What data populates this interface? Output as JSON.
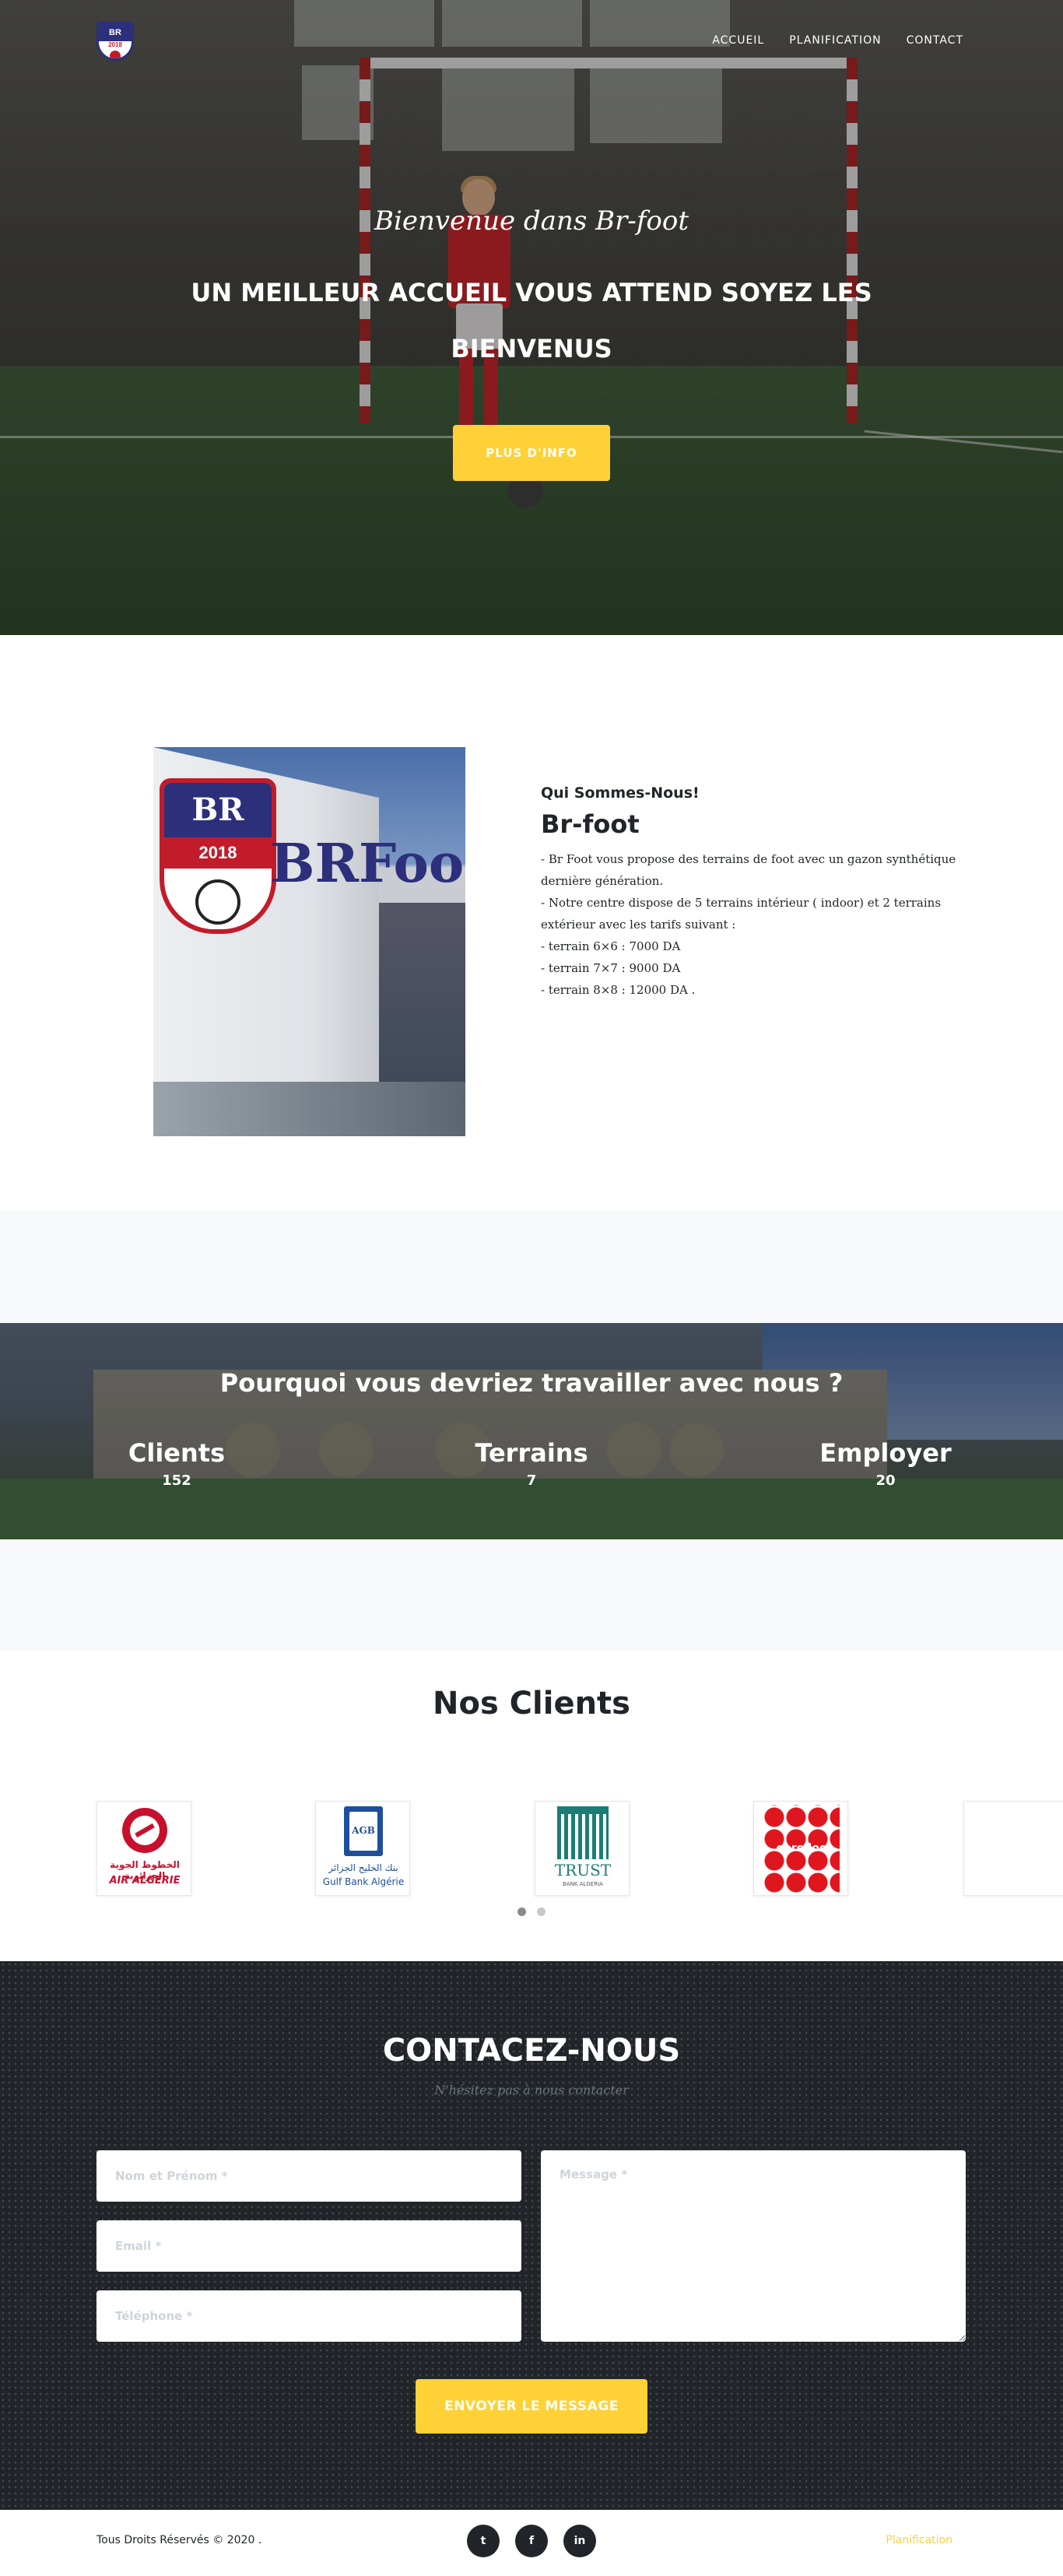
{
  "nav": {
    "logo_text": "BR",
    "logo_year": "2018",
    "items": [
      "ACCUEIL",
      "PLANIFICATION",
      "CONTACT"
    ]
  },
  "hero": {
    "subtitle": "Bienvenue dans Br-foot",
    "title": "UN MEILLEUR ACCUEIL VOUS ATTEND SOYEZ LES BIENVENUS",
    "button": "PLUS D'INFO"
  },
  "about": {
    "crest_letters": "BR",
    "crest_year": "2018",
    "wall_text": "BRFoot",
    "label": "Qui Sommes-Nous!",
    "title": "Br-foot",
    "lines": [
      "- Br Foot vous propose des terrains de foot avec un gazon synthétique",
      "dernière génération.",
      "- Notre centre dispose de 5 terrains intérieur ( indoor) et 2 terrains",
      "extérieur avec les tarifs suivant :",
      "- terrain 6×6 : 7000 DA",
      "- terrain 7×7 : 9000 DA",
      "- terrain 8×8 : 12000 DA ."
    ]
  },
  "stats": {
    "title": "Pourquoi vous devriez travailler avec nous ?",
    "items": [
      {
        "label": "Clients",
        "value": "152"
      },
      {
        "label": "Terrains",
        "value": "7"
      },
      {
        "label": "Employer",
        "value": "20"
      }
    ]
  },
  "clients": {
    "title": "Nos Clients",
    "logos": [
      {
        "name": "AIR ALGÉRIE",
        "arabic": "الخطوط الجوية الجزائرية",
        "color": "#c8102e"
      },
      {
        "name": "Gulf Bank Algérie",
        "arabic": "بنك الخليج الجزائر",
        "abbr": "AGB",
        "color": "#1f4e9c"
      },
      {
        "name": "TRUST",
        "sub": "BANK ALGERIA",
        "color": "#1b7d74"
      },
      {
        "name": "ooredoo",
        "color": "#e0161f"
      }
    ]
  },
  "contact": {
    "title": "CONTACEZ-NOUS",
    "subtitle": "N'hésitez pas à nous contacter",
    "name_placeholder": "Nom et Prénom *",
    "email_placeholder": "Email *",
    "phone_placeholder": "Téléphone *",
    "message_placeholder": "Message *",
    "button": "ENVOYER LE MESSAGE"
  },
  "footer": {
    "copyright": "Tous Droits Réservés © 2020 .",
    "socials": [
      {
        "icon": "twitter-icon",
        "glyph": "t"
      },
      {
        "icon": "facebook-icon",
        "glyph": "f"
      },
      {
        "icon": "linkedin-icon",
        "glyph": "in"
      }
    ],
    "link": "Planification"
  },
  "colors": {
    "accent": "#fed136",
    "dark": "#212529",
    "brand_blue": "#2c2f7a",
    "brand_red": "#c21c2b"
  }
}
